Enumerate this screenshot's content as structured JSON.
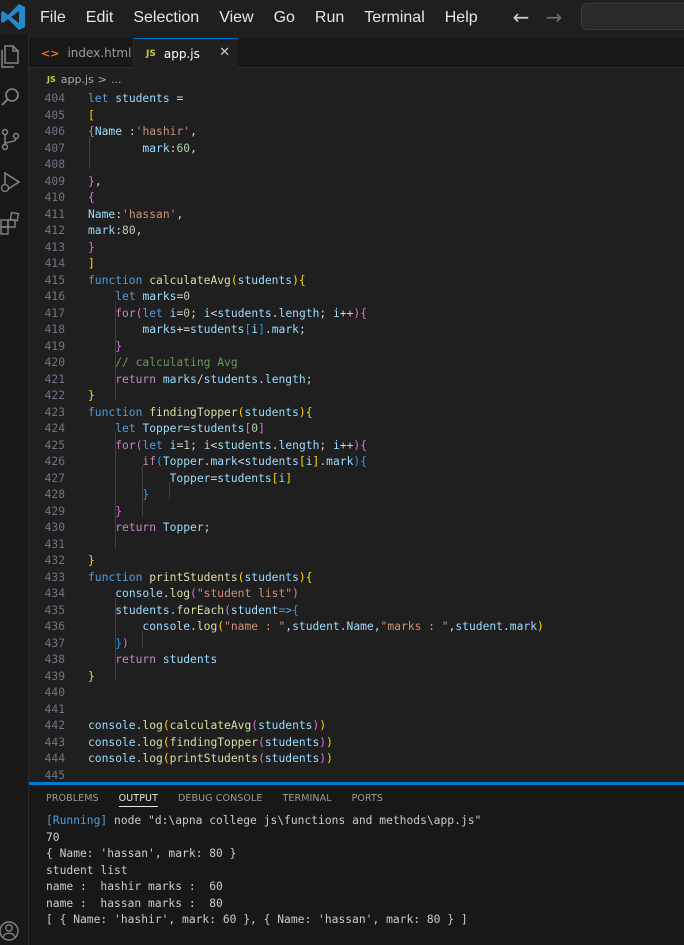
{
  "menu": [
    "File",
    "Edit",
    "Selection",
    "View",
    "Go",
    "Run",
    "Terminal",
    "Help"
  ],
  "icons": {
    "logo": "vscode-logo-icon",
    "back": "arrow-left-icon",
    "forward": "arrow-right-icon",
    "explorer": "files-icon",
    "search": "search-icon",
    "scm": "source-control-icon",
    "debug": "run-debug-icon",
    "extensions": "extensions-icon",
    "account": "account-icon"
  },
  "nav": {
    "back": "←",
    "forward": "→"
  },
  "tabs": [
    {
      "icon": "<>",
      "label": "index.html"
    },
    {
      "icon": "JS",
      "label": "app.js",
      "close": "✕"
    }
  ],
  "breadcrumb": {
    "icon": "JS",
    "file": "app.js",
    "sep": ">",
    "rest": "..."
  },
  "code": {
    "l404": "404",
    "l405": "405",
    "l406": "406",
    "l407": "407",
    "l408": "408",
    "l409": "409",
    "l410": "410",
    "l411": "411",
    "l412": "412",
    "l413": "413",
    "l414": "414",
    "l415": "415",
    "l416": "416",
    "l417": "417",
    "l418": "418",
    "l419": "419",
    "l420": "420",
    "l421": "421",
    "l422": "422",
    "l423": "423",
    "l424": "424",
    "l425": "425",
    "l426": "426",
    "l427": "427",
    "l428": "428",
    "l429": "429",
    "l430": "430",
    "l431": "431",
    "l432": "432",
    "l433": "433",
    "l434": "434",
    "l435": "435",
    "l436": "436",
    "l437": "437",
    "l438": "438",
    "l439": "439",
    "l440": "440",
    "l441": "441",
    "l442": "442",
    "l443": "443",
    "l444": "444",
    "l445": "445",
    "let": "let",
    "function": "function",
    "for": "for",
    "if": "if",
    "return": "return",
    "students": "students",
    "Name": "Name",
    "mark": "mark",
    "marks": "marks",
    "i": "i",
    "Topper": "Topper",
    "student": "student",
    "length": "length",
    "calculateAvg": "calculateAvg",
    "findingTopper": "findingTopper",
    "printStudents": "printStudents",
    "console": "console",
    "log": "log",
    "forEach": "forEach",
    "hashir": "'hashir'",
    "hassan": "'hassan'",
    "n60": "60",
    "n80": "80",
    "n0": "0",
    "n1": "1",
    "comment": "// calculating Avg",
    "s_list": "\"student list\"",
    "s_name": "\"name : \"",
    "s_marks": "\"marks : \""
  },
  "panel": {
    "tabs": [
      "PROBLEMS",
      "OUTPUT",
      "DEBUG CONSOLE",
      "TERMINAL",
      "PORTS"
    ],
    "active": "OUTPUT",
    "running": "[Running]",
    "command": " node \"d:\\apna college js\\functions and methods\\app.js\"",
    "output": [
      "70",
      "{ Name: 'hassan', mark: 80 }",
      "student list",
      "name :  hashir marks :  60",
      "name :  hassan marks :  80",
      "[ { Name: 'hashir', mark: 60 }, { Name: 'hassan', mark: 80 } ]"
    ]
  }
}
